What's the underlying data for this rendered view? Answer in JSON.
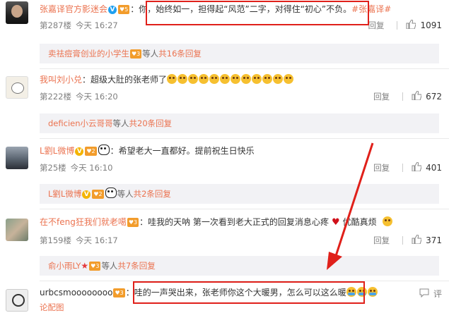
{
  "colors": {
    "username": "#eb7350",
    "highlight": "#e0201a",
    "meta": "#808080",
    "subbg": "#f2f2f5"
  },
  "comments": [
    {
      "user": "张嘉译官方影迷会",
      "text": "：你，始终如一，担得起“风范”二字，对得住“初心”不负。",
      "hashtag": "#张嘉译#",
      "floor": "第287楼",
      "time": "今天 16:27",
      "reply": "回复",
      "likes": "1091",
      "sub_name": "卖祛痘膏创业的小学生",
      "sub_rest": "等人",
      "sub_total": "共16条回复"
    },
    {
      "user": "我叫刘小兑",
      "text": "：超级大肚的张老师了",
      "floor": "第222楼",
      "time": "今天 16:20",
      "reply": "回复",
      "likes": "672",
      "sub_name": "deficien小云哥哥",
      "sub_rest": "等人",
      "sub_total": "共20条回复"
    },
    {
      "user": "L劉L微博",
      "text": "：希望老大一直都好。提前祝生日快乐",
      "floor": "第25楼",
      "time": "今天 16:10",
      "reply": "回复",
      "likes": "401",
      "sub_name": "L劉L微博",
      "sub_rest": "等人",
      "sub_total": "共2条回复"
    },
    {
      "user": "在不feng狂我们就老噶",
      "text": "：哇我的天呐 第一次看到老大正式的回复消息",
      "text2": "心疼",
      "text3": "优酷真烦",
      "floor": "第159楼",
      "time": "今天 16:17",
      "reply": "回复",
      "likes": "371",
      "sub_name": "俞小雨LY",
      "sub_rest": "等人",
      "sub_total": "共7条回复"
    },
    {
      "user": "urbcsmoooooooo",
      "text": "：哇的一声哭出来，张老师你这个大暖男，怎么可以这么暖",
      "more": "评",
      "trail": "论配图"
    }
  ],
  "icons": {
    "thumb": "thumb-up-icon",
    "emoji": "smile-emoji-icon",
    "cry": "cry-emoji-icon",
    "arrow": "red-arrow-annotation"
  }
}
